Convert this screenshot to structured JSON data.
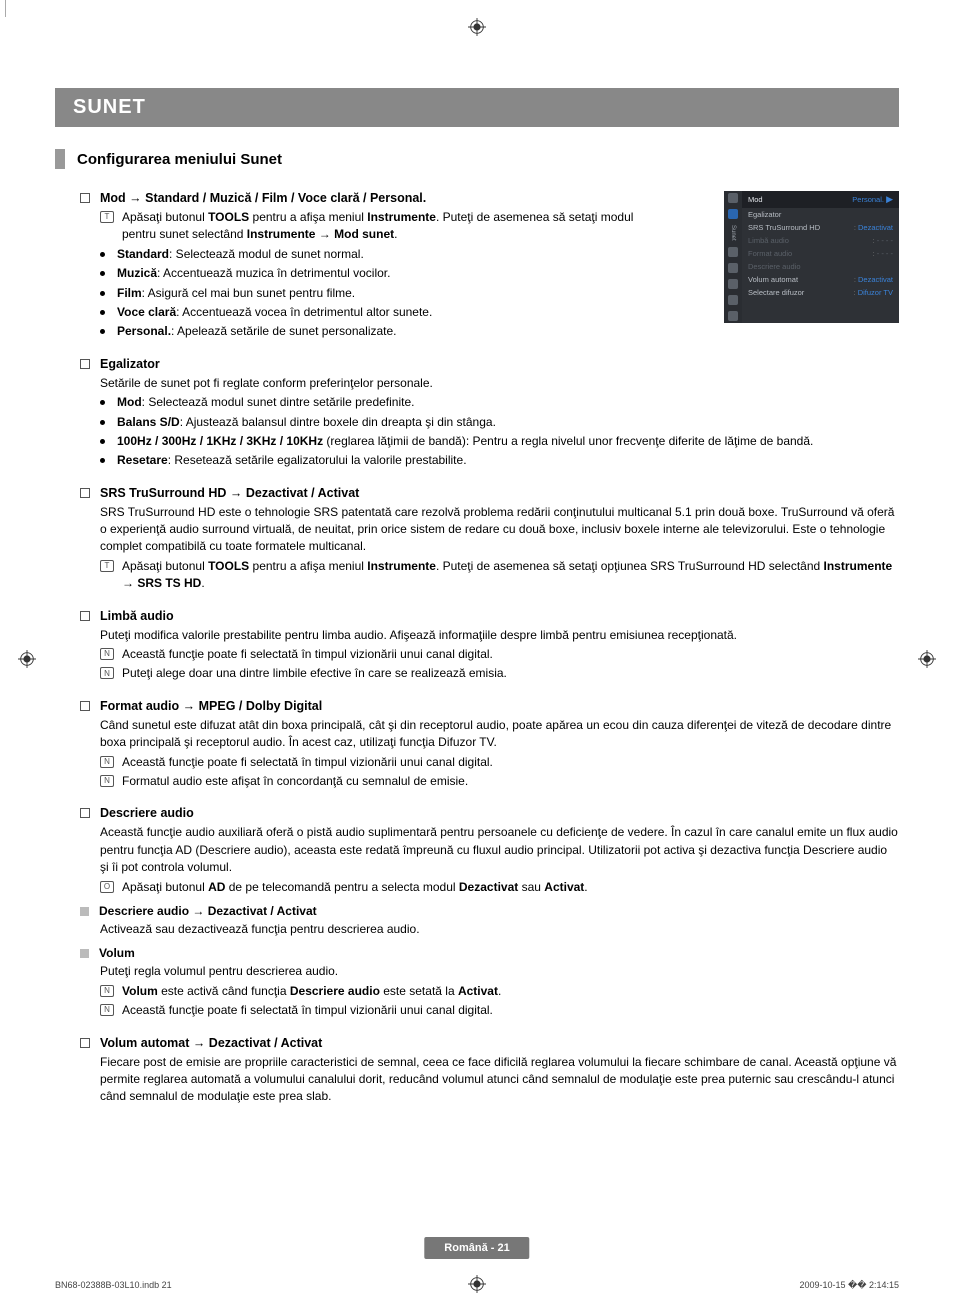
{
  "banner": "SUNET",
  "section_title": "Configurarea meniului Sunet",
  "mod": {
    "heading": "Mod → Standard / Muzică / Film / Voce clară / Personal.",
    "tools_note_plain": "Apăsaţi butonul TOOLS pentru a afişa meniul Instrumente. Puteţi de asemenea să setaţi modul pentru sunet selectând Instrumente → Mod sunet.",
    "items": [
      {
        "t": "Standard",
        "d": ": Selectează modul de sunet normal."
      },
      {
        "t": "Muzică",
        "d": ": Accentuează muzica în detrimentul vocilor."
      },
      {
        "t": "Film",
        "d": ": Asigură cel mai bun sunet pentru filme."
      },
      {
        "t": "Voce clară",
        "d": ": Accentuează vocea în detrimentul altor sunete."
      },
      {
        "t": "Personal.",
        "d": ": Apelează setările de sunet personalizate."
      }
    ]
  },
  "egal": {
    "heading": "Egalizator",
    "intro": "Setările de sunet pot fi reglate conform preferinţelor personale.",
    "items": [
      {
        "t": "Mod",
        "d": ": Selectează modul sunet dintre setările predefinite."
      },
      {
        "t": "Balans S/D",
        "d": ": Ajustează balansul dintre boxele din dreapta şi din stânga."
      },
      {
        "t": "100Hz / 300Hz / 1KHz / 3KHz / 10KHz",
        "d": " (reglarea lăţimii de bandă): Pentru a regla nivelul unor frecvenţe diferite de lăţime de bandă."
      },
      {
        "t": "Resetare",
        "d": ": Resetează setările egalizatorului la valorile prestabilite."
      }
    ]
  },
  "srs": {
    "heading": "SRS TruSurround HD → Dezactivat / Activat",
    "para": "SRS TruSurround HD este o tehnologie SRS patentată care rezolvă problema redării conţinutului multicanal 5.1 prin două boxe. TruSurround vă oferă o experienţă audio surround virtuală, de neuitat, prin orice sistem de redare cu două boxe, inclusiv boxele interne ale televizorului. Este o tehnologie complet compatibilă cu toate formatele multicanal.",
    "tools_note_plain": "Apăsaţi butonul TOOLS pentru a afişa meniul Instrumente. Puteţi de asemenea să setaţi opţiunea SRS TruSurround HD selectând Instrumente → SRS TS HD."
  },
  "limba": {
    "heading": "Limbă audio",
    "para": "Puteţi modifica valorile prestabilite pentru limba audio. Afişează informaţiile despre limbă pentru emisiunea recepţionată.",
    "notes": [
      "Această funcţie poate fi selectată în timpul vizionării unui canal digital.",
      "Puteţi alege doar una dintre limbile efective în care se realizează emisia."
    ]
  },
  "format": {
    "heading": "Format audio → MPEG / Dolby Digital",
    "para": "Când sunetul este difuzat atât din boxa principală, cât şi din receptorul audio, poate apărea un ecou din cauza diferenţei de viteză de decodare dintre boxa principală şi receptorul audio. În acest caz, utilizaţi funcţia Difuzor TV.",
    "notes": [
      "Această funcţie poate fi selectată în timpul vizionării unui canal digital.",
      "Formatul audio este afişat în concordanţă cu semnalul de emisie."
    ]
  },
  "descr": {
    "heading": "Descriere audio",
    "para": "Această funcţie audio auxiliară oferă o pistă audio suplimentară pentru persoanele cu deficienţe de vedere. În cazul în care canalul emite un flux audio pentru funcţia AD (Descriere audio), aceasta este redată împreună cu fluxul audio principal. Utilizatorii pot activa şi dezactiva funcţia Descriere audio şi îi pot controla volumul.",
    "remote_note_plain": "Apăsaţi butonul AD de pe telecomandă pentru a selecta modul Dezactivat sau Activat.",
    "sub1": {
      "heading": "Descriere audio → Dezactivat / Activat",
      "para": "Activează sau dezactivează funcţia pentru descrierea audio."
    },
    "sub2": {
      "heading": "Volum",
      "para": "Puteţi regla volumul pentru descrierea audio.",
      "note1_a": "Volum",
      "note1_b": " este activă când funcţia ",
      "note1_c": "Descriere audio",
      "note1_d": " este setată la ",
      "note1_e": "Activat",
      "note1_f": ".",
      "note2": "Această funcţie poate fi selectată în timpul vizionării unui canal digital."
    }
  },
  "volauto": {
    "heading": "Volum automat → Dezactivat / Activat",
    "para": "Fiecare post de emisie are propriile caracteristici de semnal, ceea ce face dificilă reglarea volumului la fiecare schimbare de canal. Această opţiune vă permite reglarea automată a volumului canalului dorit, reducând volumul atunci când semnalul de modulaţie este prea puternic sau crescându-l atunci când semnalul de modulaţie este prea slab."
  },
  "osd": {
    "side_label": "Sunet",
    "top_key": "Mod",
    "top_val": "Personal.",
    "rows": [
      {
        "k": "Egalizator",
        "v": "",
        "dim": false
      },
      {
        "k": "SRS TruSurround HD",
        "v": "Dezactivat",
        "dim": false
      },
      {
        "k": "Limbă audio",
        "v": "- - - -",
        "dim": true
      },
      {
        "k": "Format audio",
        "v": "- - - -",
        "dim": true
      },
      {
        "k": "Descriere audio",
        "v": "",
        "dim": true
      },
      {
        "k": "Volum automat",
        "v": "Dezactivat",
        "dim": false
      },
      {
        "k": "Selectare difuzor",
        "v": "Difuzor TV",
        "dim": false
      }
    ]
  },
  "footer_badge": "Română - 21",
  "footer_left": "BN68-02388B-03L10.indb   21",
  "footer_right": "2009-10-15   �� 2:14:15",
  "icons": {
    "tools": "T",
    "note": "N",
    "remote": "O"
  }
}
